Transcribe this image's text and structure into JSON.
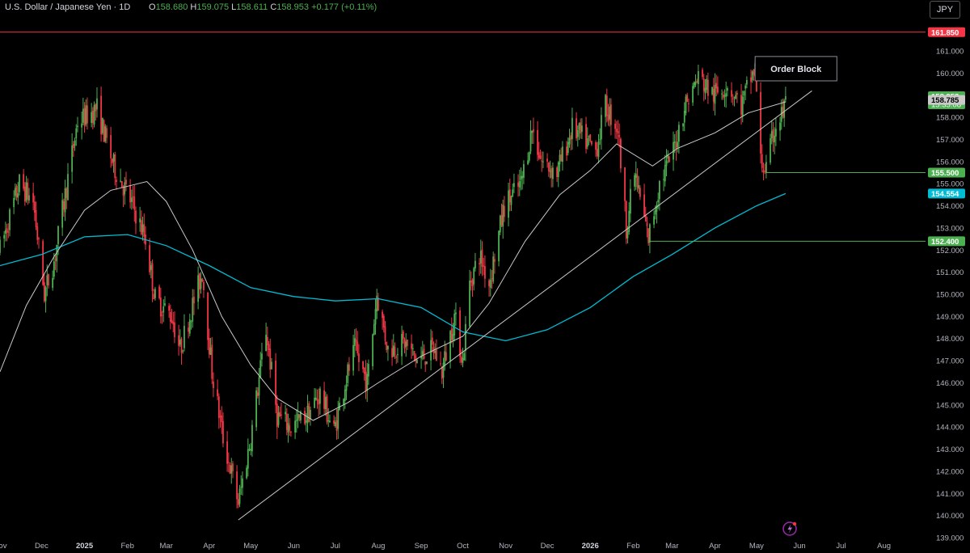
{
  "header": {
    "symbol_title": "U.S. Dollar / Japanese Yen · 1D",
    "ohlc": {
      "open_label": "O",
      "open": "158.680",
      "high_label": "H",
      "high": "159.075",
      "low_label": "L",
      "low": "158.611",
      "close_label": "C",
      "close": "158.953",
      "change": "+0.177 (+0.11%)"
    },
    "currency_button": "JPY"
  },
  "colors": {
    "up": "#4caf50",
    "down": "#f23645",
    "ma_slow": "#00bcd4",
    "ma_fast": "#c9c9c9",
    "resistance_line": "#f23645",
    "trendline": "#c9c9c9",
    "level_line": "#4caf50",
    "background": "#000000",
    "axis_text": "#b2b5be"
  },
  "chart_data": {
    "type": "candlestick",
    "y_axis": {
      "ylim": [
        139.0,
        162.5
      ],
      "tick_labels": [
        "139.000",
        "140.000",
        "141.000",
        "142.000",
        "143.000",
        "144.000",
        "145.000",
        "146.000",
        "147.000",
        "148.000",
        "149.000",
        "150.000",
        "151.000",
        "152.000",
        "153.000",
        "154.000",
        "155.000",
        "156.000",
        "157.000",
        "158.000",
        "159.000",
        "160.000",
        "161.000"
      ]
    },
    "x_axis": {
      "xlim": [
        "2024-11-01",
        "2026-08-31"
      ],
      "tick_labels": [
        {
          "date": "2024-11-01",
          "label": "Nov",
          "bold": false
        },
        {
          "date": "2024-12-01",
          "label": "Dec",
          "bold": false
        },
        {
          "date": "2025-01-01",
          "label": "2025",
          "bold": true
        },
        {
          "date": "2025-02-01",
          "label": "Feb",
          "bold": false
        },
        {
          "date": "2025-03-01",
          "label": "Mar",
          "bold": false
        },
        {
          "date": "2025-04-01",
          "label": "Apr",
          "bold": false
        },
        {
          "date": "2025-05-01",
          "label": "May",
          "bold": false
        },
        {
          "date": "2025-06-01",
          "label": "Jun",
          "bold": false
        },
        {
          "date": "2025-07-01",
          "label": "Jul",
          "bold": false
        },
        {
          "date": "2025-08-01",
          "label": "Aug",
          "bold": false
        },
        {
          "date": "2025-09-01",
          "label": "Sep",
          "bold": false
        },
        {
          "date": "2025-10-01",
          "label": "Oct",
          "bold": false
        },
        {
          "date": "2025-11-01",
          "label": "Nov",
          "bold": false
        },
        {
          "date": "2025-12-01",
          "label": "Dec",
          "bold": false
        },
        {
          "date": "2026-01-01",
          "label": "2026",
          "bold": true
        },
        {
          "date": "2026-02-01",
          "label": "Feb",
          "bold": false
        },
        {
          "date": "2026-03-01",
          "label": "Mar",
          "bold": false
        },
        {
          "date": "2026-04-01",
          "label": "Apr",
          "bold": false
        },
        {
          "date": "2026-05-01",
          "label": "May",
          "bold": false
        },
        {
          "date": "2026-06-01",
          "label": "Jun",
          "bold": false
        },
        {
          "date": "2026-07-01",
          "label": "Jul",
          "bold": false
        },
        {
          "date": "2026-08-01",
          "label": "Aug",
          "bold": false
        }
      ]
    },
    "price_path": [
      [
        "2024-11-01",
        152.0
      ],
      [
        "2024-11-15",
        155.0
      ],
      [
        "2024-11-25",
        154.2
      ],
      [
        "2024-12-03",
        150.0
      ],
      [
        "2024-12-10",
        151.5
      ],
      [
        "2024-12-18",
        154.5
      ],
      [
        "2024-12-27",
        157.8
      ],
      [
        "2025-01-10",
        158.4
      ],
      [
        "2025-01-22",
        155.8
      ],
      [
        "2025-02-05",
        154.0
      ],
      [
        "2025-02-14",
        152.5
      ],
      [
        "2025-02-21",
        149.8
      ],
      [
        "2025-03-05",
        149.0
      ],
      [
        "2025-03-11",
        147.5
      ],
      [
        "2025-03-20",
        149.5
      ],
      [
        "2025-03-27",
        151.0
      ],
      [
        "2025-04-03",
        146.5
      ],
      [
        "2025-04-11",
        143.5
      ],
      [
        "2025-04-22",
        140.6
      ],
      [
        "2025-05-01",
        143.5
      ],
      [
        "2025-05-12",
        148.4
      ],
      [
        "2025-05-20",
        144.5
      ],
      [
        "2025-05-30",
        144.0
      ],
      [
        "2025-06-10",
        144.5
      ],
      [
        "2025-06-20",
        145.5
      ],
      [
        "2025-06-30",
        143.8
      ],
      [
        "2025-07-08",
        146.0
      ],
      [
        "2025-07-15",
        147.5
      ],
      [
        "2025-07-24",
        146.0
      ],
      [
        "2025-07-31",
        150.0
      ],
      [
        "2025-08-08",
        147.5
      ],
      [
        "2025-08-20",
        147.8
      ],
      [
        "2025-08-29",
        147.0
      ],
      [
        "2025-09-10",
        147.5
      ],
      [
        "2025-09-16",
        146.5
      ],
      [
        "2025-09-25",
        149.0
      ],
      [
        "2025-10-01",
        147.0
      ],
      [
        "2025-10-06",
        150.5
      ],
      [
        "2025-10-13",
        151.8
      ],
      [
        "2025-10-20",
        150.5
      ],
      [
        "2025-10-31",
        154.0
      ],
      [
        "2025-11-12",
        155.0
      ],
      [
        "2025-11-20",
        157.5
      ],
      [
        "2025-11-27",
        156.0
      ],
      [
        "2025-12-08",
        155.5
      ],
      [
        "2025-12-19",
        157.5
      ],
      [
        "2026-01-05",
        156.5
      ],
      [
        "2026-01-12",
        158.5
      ],
      [
        "2026-01-21",
        157.5
      ],
      [
        "2026-01-27",
        153.0
      ],
      [
        "2026-02-02",
        155.5
      ],
      [
        "2026-02-12",
        152.5
      ],
      [
        "2026-02-20",
        155.0
      ],
      [
        "2026-03-02",
        156.5
      ],
      [
        "2026-03-10",
        158.5
      ],
      [
        "2026-03-20",
        159.8
      ],
      [
        "2026-03-31",
        159.0
      ],
      [
        "2026-04-10",
        159.5
      ],
      [
        "2026-04-20",
        158.5
      ],
      [
        "2026-04-27",
        159.8
      ],
      [
        "2026-04-30",
        160.2
      ],
      [
        "2026-05-04",
        156.0
      ],
      [
        "2026-05-08",
        155.6
      ],
      [
        "2026-05-14",
        157.5
      ],
      [
        "2026-05-20",
        158.2
      ],
      [
        "2026-05-22",
        158.953
      ]
    ],
    "moving_averages": [
      {
        "role": "slow",
        "last_value": 154.554,
        "points": [
          [
            "2024-11-01",
            151.3
          ],
          [
            "2024-12-01",
            151.8
          ],
          [
            "2025-01-01",
            152.6
          ],
          [
            "2025-02-01",
            152.7
          ],
          [
            "2025-03-01",
            152.2
          ],
          [
            "2025-04-01",
            151.3
          ],
          [
            "2025-05-01",
            150.3
          ],
          [
            "2025-06-01",
            149.9
          ],
          [
            "2025-07-01",
            149.7
          ],
          [
            "2025-08-01",
            149.8
          ],
          [
            "2025-09-01",
            149.4
          ],
          [
            "2025-10-01",
            148.3
          ],
          [
            "2025-11-01",
            147.9
          ],
          [
            "2025-12-01",
            148.4
          ],
          [
            "2026-01-01",
            149.4
          ],
          [
            "2026-02-01",
            150.8
          ],
          [
            "2026-03-01",
            151.8
          ],
          [
            "2026-04-01",
            153.0
          ],
          [
            "2026-05-01",
            154.0
          ],
          [
            "2026-05-22",
            154.554
          ]
        ]
      },
      {
        "role": "fast",
        "last_value": null,
        "points": [
          [
            "2024-11-01",
            146.5
          ],
          [
            "2024-11-20",
            149.5
          ],
          [
            "2024-12-10",
            151.7
          ],
          [
            "2025-01-01",
            153.8
          ],
          [
            "2025-01-20",
            154.7
          ],
          [
            "2025-02-15",
            155.1
          ],
          [
            "2025-03-01",
            154.2
          ],
          [
            "2025-03-20",
            152.0
          ],
          [
            "2025-04-10",
            149.0
          ],
          [
            "2025-05-01",
            146.8
          ],
          [
            "2025-05-20",
            145.3
          ],
          [
            "2025-06-15",
            144.3
          ],
          [
            "2025-07-10",
            145.1
          ],
          [
            "2025-08-01",
            146.0
          ],
          [
            "2025-09-01",
            147.2
          ],
          [
            "2025-10-01",
            148.1
          ],
          [
            "2025-10-20",
            149.6
          ],
          [
            "2025-11-15",
            152.4
          ],
          [
            "2025-12-10",
            154.5
          ],
          [
            "2026-01-01",
            155.6
          ],
          [
            "2026-01-20",
            156.8
          ],
          [
            "2026-02-15",
            155.8
          ],
          [
            "2026-03-05",
            156.6
          ],
          [
            "2026-04-01",
            157.3
          ],
          [
            "2026-04-25",
            158.2
          ],
          [
            "2026-05-22",
            158.7
          ]
        ]
      }
    ],
    "horizontal_levels": [
      {
        "value": 161.85,
        "label": "161.850",
        "from": "2024-11-01",
        "role": "resistance"
      },
      {
        "value": 155.5,
        "label": "155.500",
        "from": "2026-05-08",
        "role": "support"
      },
      {
        "value": 152.4,
        "label": "152.400",
        "from": "2026-02-12",
        "role": "support"
      }
    ],
    "trendline": {
      "from": [
        "2025-04-22",
        139.8
      ],
      "to": [
        "2026-06-10",
        159.2
      ]
    },
    "order_block": {
      "label": "Order Block",
      "from": "2026-04-30",
      "to": "2026-06-28",
      "top": 160.75,
      "bottom": 159.65
    },
    "price_badges": [
      {
        "value": 158.953,
        "text": "158.953",
        "subtext": "15:35:08",
        "style": "last-price"
      },
      {
        "value": 158.785,
        "text": "158.785",
        "subtext": "",
        "style": "ma-fast"
      },
      {
        "value": 154.554,
        "text": "154.554",
        "subtext": "",
        "style": "ma-slow"
      }
    ]
  }
}
